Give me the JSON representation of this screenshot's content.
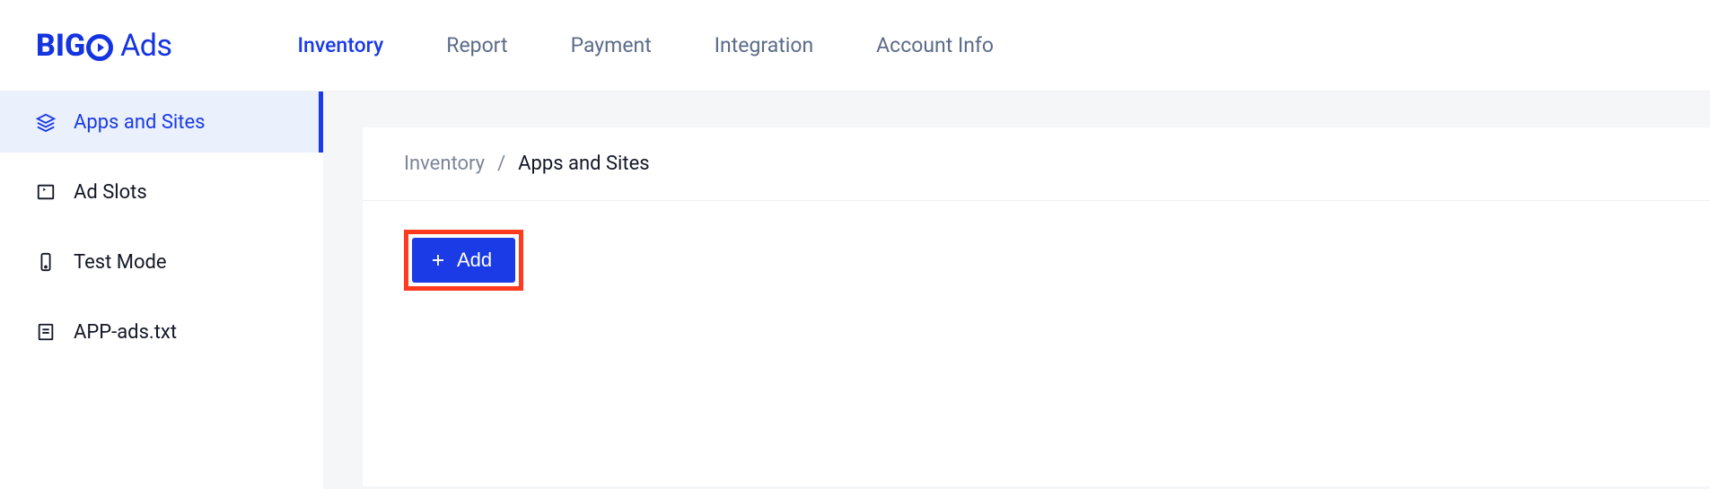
{
  "logo": {
    "brand": "BIG",
    "suffix": "Ads"
  },
  "topnav": {
    "items": [
      {
        "label": "Inventory",
        "active": true
      },
      {
        "label": "Report",
        "active": false
      },
      {
        "label": "Payment",
        "active": false
      },
      {
        "label": "Integration",
        "active": false
      },
      {
        "label": "Account Info",
        "active": false
      }
    ]
  },
  "sidebar": {
    "items": [
      {
        "label": "Apps and Sites",
        "icon": "layers-icon",
        "active": true
      },
      {
        "label": "Ad Slots",
        "icon": "ad-slot-icon",
        "active": false
      },
      {
        "label": "Test Mode",
        "icon": "mobile-icon",
        "active": false
      },
      {
        "label": "APP-ads.txt",
        "icon": "file-text-icon",
        "active": false
      }
    ]
  },
  "breadcrumb": {
    "root": "Inventory",
    "current": "Apps and Sites"
  },
  "actions": {
    "add_label": "Add"
  },
  "colors": {
    "primary": "#1a3be5",
    "highlight_border": "#ff3b1f",
    "text_muted": "#5b6b88"
  }
}
